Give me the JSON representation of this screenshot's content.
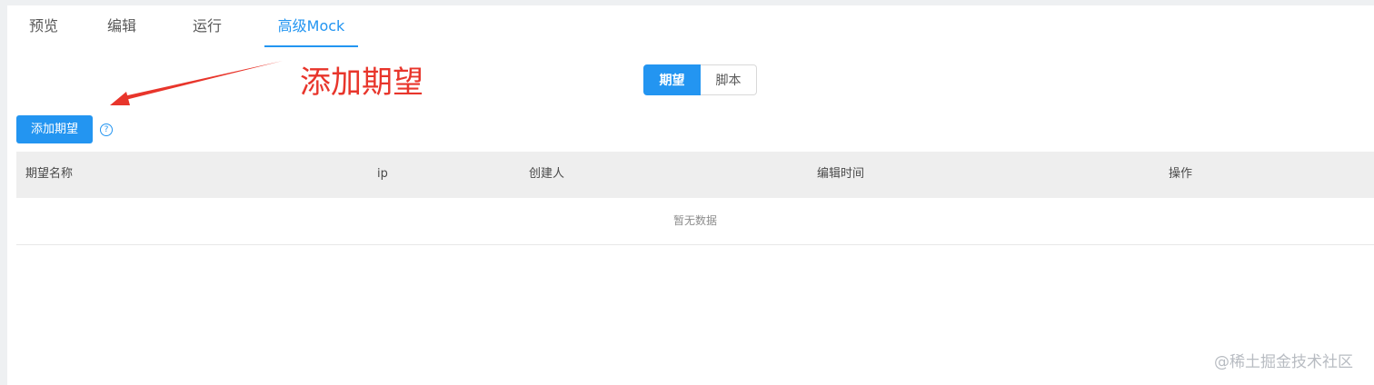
{
  "tabs": [
    {
      "label": "预览"
    },
    {
      "label": "编辑"
    },
    {
      "label": "运行"
    },
    {
      "label": "高级Mock"
    }
  ],
  "active_tab": "高级Mock",
  "segment": {
    "options": [
      "期望",
      "脚本"
    ],
    "selected": "期望"
  },
  "annotation": {
    "text": "添加期望",
    "color": "#e8352b"
  },
  "toolbar": {
    "add_label": "添加期望",
    "help_glyph": "?"
  },
  "table": {
    "columns": [
      "期望名称",
      "ip",
      "创建人",
      "编辑时间",
      "操作"
    ],
    "rows": [],
    "empty_text": "暂无数据"
  },
  "watermark": "@稀土掘金技术社区",
  "colors": {
    "accent": "#2395f1",
    "header_bg": "#eeeeee"
  }
}
